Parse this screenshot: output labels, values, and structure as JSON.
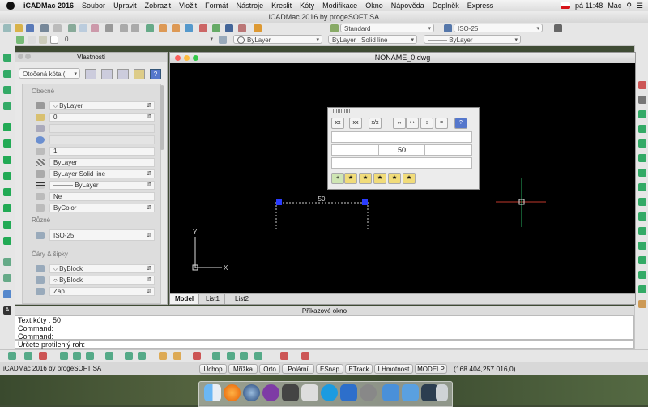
{
  "menubar": {
    "app_name": "iCADMac 2016",
    "items": [
      "Soubor",
      "Upravit",
      "Zobrazit",
      "Vložit",
      "Formát",
      "Nástroje",
      "Kreslit",
      "Kóty",
      "Modifikace",
      "Okno",
      "Nápověda",
      "Doplněk",
      "Express"
    ],
    "clock": "pá 11:48",
    "user": "Mac"
  },
  "window_title": "iCADMac 2016 by progeSOFT SA",
  "toolbar1": {
    "text_style": "Standard",
    "dim_style": "ISO-25"
  },
  "toolbar2": {
    "layer_value": "0",
    "color": "ByLayer",
    "linetype_label": "ByLayer",
    "linetype_name": "Solid line",
    "lineweight": "——— ByLayer"
  },
  "properties": {
    "title": "Vlastnosti",
    "selector": "Otočená kóta (",
    "section_general": "Obecné",
    "general_rows": [
      "ByLayer",
      "0",
      "",
      "",
      "1",
      "ByLayer",
      "ByLayer      Solid line",
      "——— ByLayer",
      "Ne",
      "ByColor"
    ],
    "section_misc": "Různé",
    "misc_rows": [
      "ISO-25"
    ],
    "section_lines": "Čáry & šipky",
    "lines_rows": [
      "ByBlock",
      "ByBlock",
      "Zap"
    ]
  },
  "drawing": {
    "title": "NONAME_0.dwg",
    "dimension_text": "50",
    "ucs_x": "X",
    "ucs_y": "Y",
    "tabs": [
      "Model",
      "List1",
      "List2"
    ]
  },
  "dim_panel": {
    "value": "50"
  },
  "command": {
    "header": "Příkazové okno",
    "lines": [
      "Text kóty : 50",
      "Command:",
      "Command:"
    ],
    "prompt": "Určete protilehlý roh:"
  },
  "statusbar": {
    "app_label": "iCADMac 2016 by progeSOFT SA",
    "buttons": [
      "Úchop",
      "Mřížka",
      "Orto",
      "Polární",
      "ESnap",
      "ETrack",
      "LHmotnost",
      "MODELP"
    ],
    "coords": "(168.404,257.016,0)"
  },
  "colors": {
    "canvas": "#000000",
    "grip": "#2a3cff",
    "crosshair_x": "#c0392b",
    "crosshair_y": "#27ae60"
  }
}
